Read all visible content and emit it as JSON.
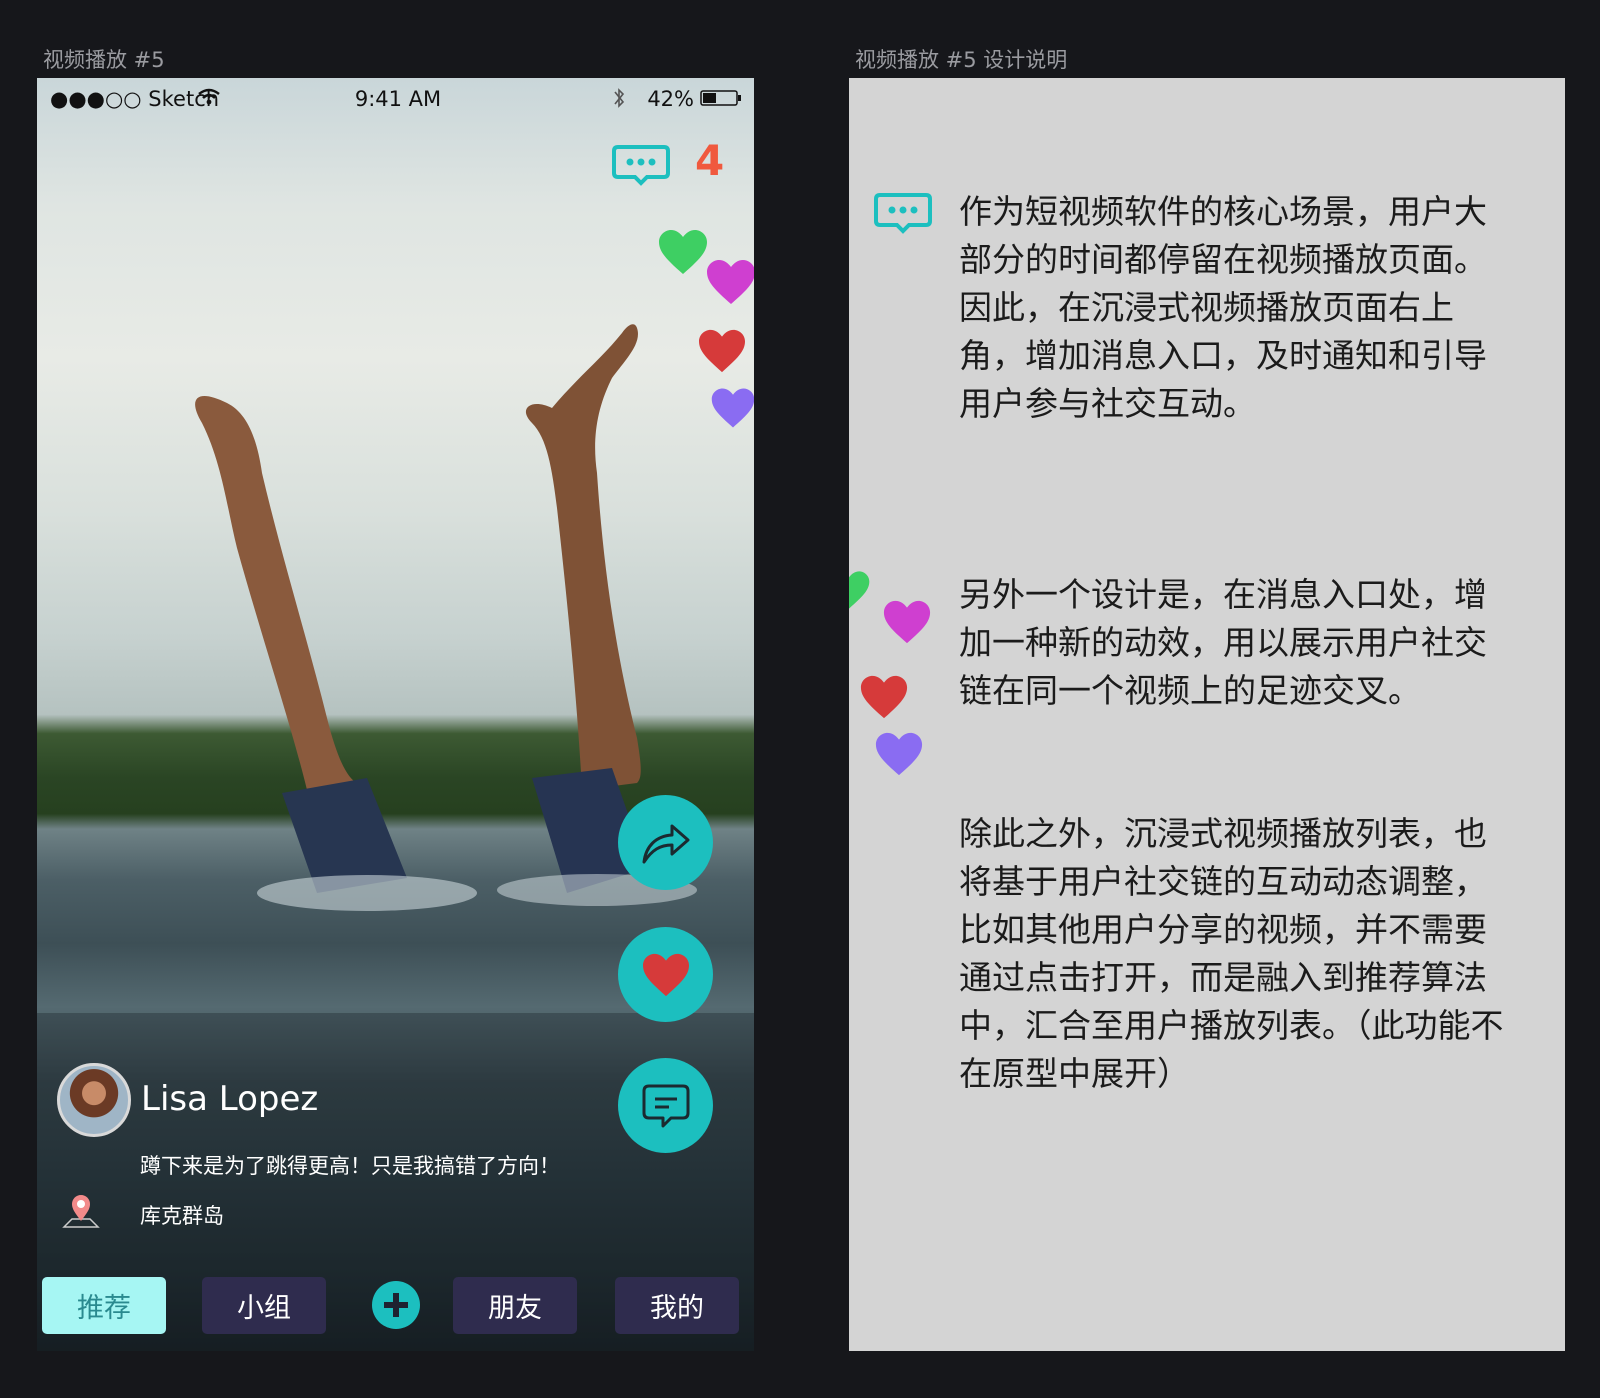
{
  "frames": {
    "left_title": "视频播放 #5",
    "right_title": "视频播放 #5 设计说明"
  },
  "status_bar": {
    "carrier": "●●●○○ Sketch",
    "time": "9:41 AM",
    "battery": "42%",
    "battery_level": 0.42
  },
  "messages": {
    "count": "4",
    "icon": "chat-dots-icon"
  },
  "floating_hearts": [
    {
      "color": "#3ecf63"
    },
    {
      "color": "#cf3fd0"
    },
    {
      "color": "#d63a3a"
    },
    {
      "color": "#8a6cf2"
    }
  ],
  "actions": {
    "share_icon": "share-arrow-icon",
    "like_icon": "heart-icon",
    "comment_icon": "comment-icon",
    "accent_color": "#1cbfbf"
  },
  "post": {
    "user_name": "Lisa Lopez",
    "caption": "蹲下来是为了跳得更高！只是我搞错了方向！",
    "location": "库克群岛"
  },
  "tabs": {
    "items": [
      "推荐",
      "小组",
      "朋友",
      "我的"
    ],
    "active": "推荐",
    "add_icon": "plus-icon"
  },
  "notes": {
    "p1": "作为短视频软件的核心场景，用户大部分的时间都停留在视频播放页面。因此，在沉浸式视频播放页面右上角，增加消息入口，及时通知和引导用户参与社交互动。",
    "p2": "另外一个设计是，在消息入口处，增加一种新的动效，用以展示用户社交链在同一个视频上的足迹交叉。",
    "p3": "除此之外，沉浸式视频播放列表，也将基于用户社交链的互动动态调整，比如其他用户分享的视频，并不需要通过点击打开，而是融入到推荐算法中，汇合至用户播放列表。（此功能不在原型中展开）"
  }
}
